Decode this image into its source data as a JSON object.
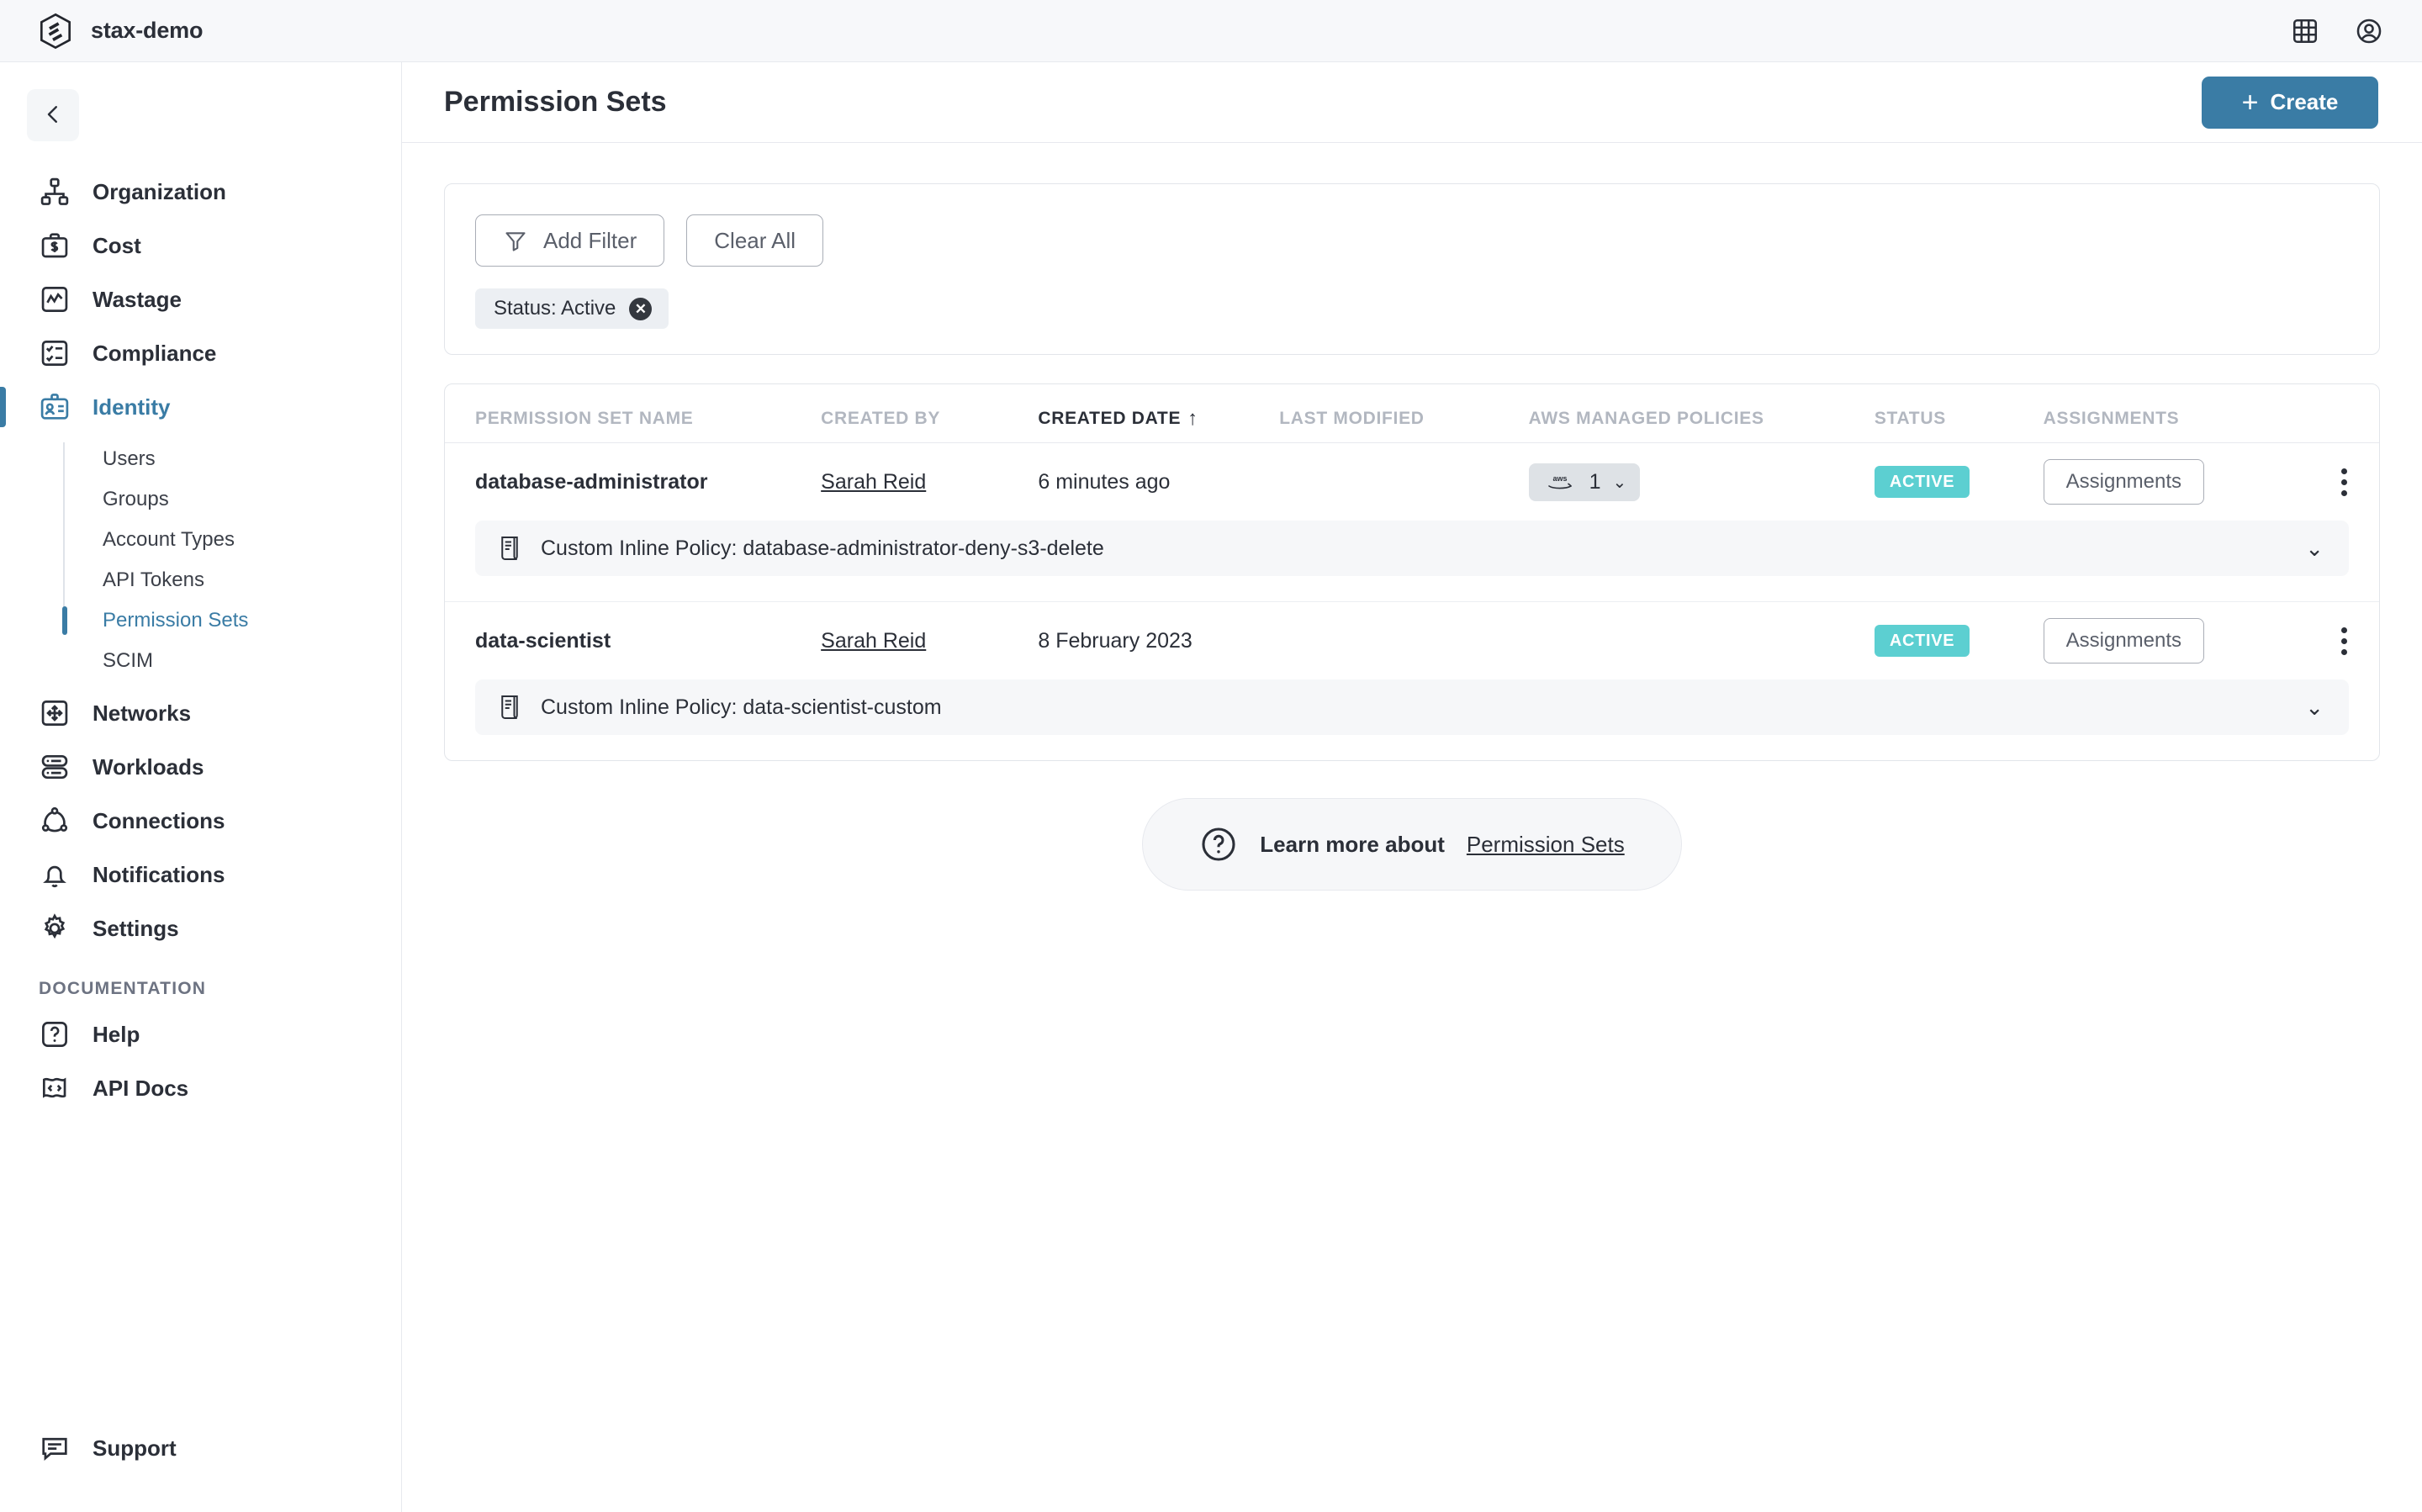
{
  "topbar": {
    "brand_name": "stax-demo",
    "logo_icon": "stax-hexagon-logo",
    "apps_icon": "grid-apps-icon",
    "account_icon": "user-account-icon"
  },
  "sidebar": {
    "collapse_icon": "chevron-left-icon",
    "items": [
      {
        "label": "Organization",
        "icon": "org-chart-icon",
        "active": false
      },
      {
        "label": "Cost",
        "icon": "briefcase-dollar-icon",
        "active": false
      },
      {
        "label": "Wastage",
        "icon": "chart-line-box-icon",
        "active": false
      },
      {
        "label": "Compliance",
        "icon": "checklist-box-icon",
        "active": false
      },
      {
        "label": "Identity",
        "icon": "id-card-icon",
        "active": true
      },
      {
        "label": "Networks",
        "icon": "move-arrows-box-icon",
        "active": false
      },
      {
        "label": "Workloads",
        "icon": "server-stack-icon",
        "active": false
      },
      {
        "label": "Connections",
        "icon": "nodes-connection-icon",
        "active": false
      },
      {
        "label": "Notifications",
        "icon": "bell-icon",
        "active": false
      },
      {
        "label": "Settings",
        "icon": "gear-icon",
        "active": false
      }
    ],
    "identity_subitems": [
      {
        "label": "Users",
        "active": false
      },
      {
        "label": "Groups",
        "active": false
      },
      {
        "label": "Account Types",
        "active": false
      },
      {
        "label": "API Tokens",
        "active": false
      },
      {
        "label": "Permission Sets",
        "active": true
      },
      {
        "label": "SCIM",
        "active": false
      }
    ],
    "documentation_title": "DOCUMENTATION",
    "documentation_items": [
      {
        "label": "Help",
        "icon": "question-box-icon"
      },
      {
        "label": "API Docs",
        "icon": "code-doc-icon"
      }
    ],
    "support": {
      "label": "Support",
      "icon": "chat-bubble-icon"
    }
  },
  "header": {
    "title": "Permission Sets",
    "create_label": "Create",
    "create_icon": "plus-icon",
    "create_color": "#3a7ca5"
  },
  "filters": {
    "add_filter_label": "Add Filter",
    "add_filter_icon": "funnel-icon",
    "clear_all_label": "Clear All",
    "chips": [
      {
        "label": "Status: Active",
        "remove_icon": "close-circle-icon"
      }
    ]
  },
  "table": {
    "columns": [
      {
        "key": "name",
        "label": "PERMISSION SET NAME",
        "sorted": false
      },
      {
        "key": "by",
        "label": "CREATED BY",
        "sorted": false
      },
      {
        "key": "date",
        "label": "CREATED DATE",
        "sorted": true,
        "sort_direction": "asc",
        "sort_icon": "arrow-up-icon"
      },
      {
        "key": "mod",
        "label": "LAST MODIFIED",
        "sorted": false
      },
      {
        "key": "pol",
        "label": "AWS MANAGED POLICIES",
        "sorted": false
      },
      {
        "key": "status",
        "label": "STATUS",
        "sorted": false
      },
      {
        "key": "assign",
        "label": "ASSIGNMENTS",
        "sorted": false
      }
    ],
    "rows": [
      {
        "name": "database-administrator",
        "created_by": "Sarah Reid",
        "created_date": "6 minutes ago",
        "last_modified": "",
        "aws_policy_count": "1",
        "aws_badge_icon": "aws-logo-icon",
        "aws_badge_chevron": "chevron-down-icon",
        "status": "ACTIVE",
        "status_color": "#5ccfd1",
        "assignments_label": "Assignments",
        "kebab_icon": "more-vertical-icon",
        "inline_policy": {
          "icon": "policy-scroll-icon",
          "text": "Custom Inline Policy: database-administrator-deny-s3-delete",
          "expand_icon": "chevron-down-icon"
        }
      },
      {
        "name": "data-scientist",
        "created_by": "Sarah Reid",
        "created_date": "8 February 2023",
        "last_modified": "",
        "aws_policy_count": "",
        "aws_badge_icon": "",
        "aws_badge_chevron": "",
        "status": "ACTIVE",
        "status_color": "#5ccfd1",
        "assignments_label": "Assignments",
        "kebab_icon": "more-vertical-icon",
        "inline_policy": {
          "icon": "policy-scroll-icon",
          "text": "Custom Inline Policy: data-scientist-custom",
          "expand_icon": "chevron-down-icon"
        }
      }
    ]
  },
  "learn_more": {
    "icon": "question-circle-icon",
    "text": "Learn more about",
    "link": "Permission Sets"
  }
}
